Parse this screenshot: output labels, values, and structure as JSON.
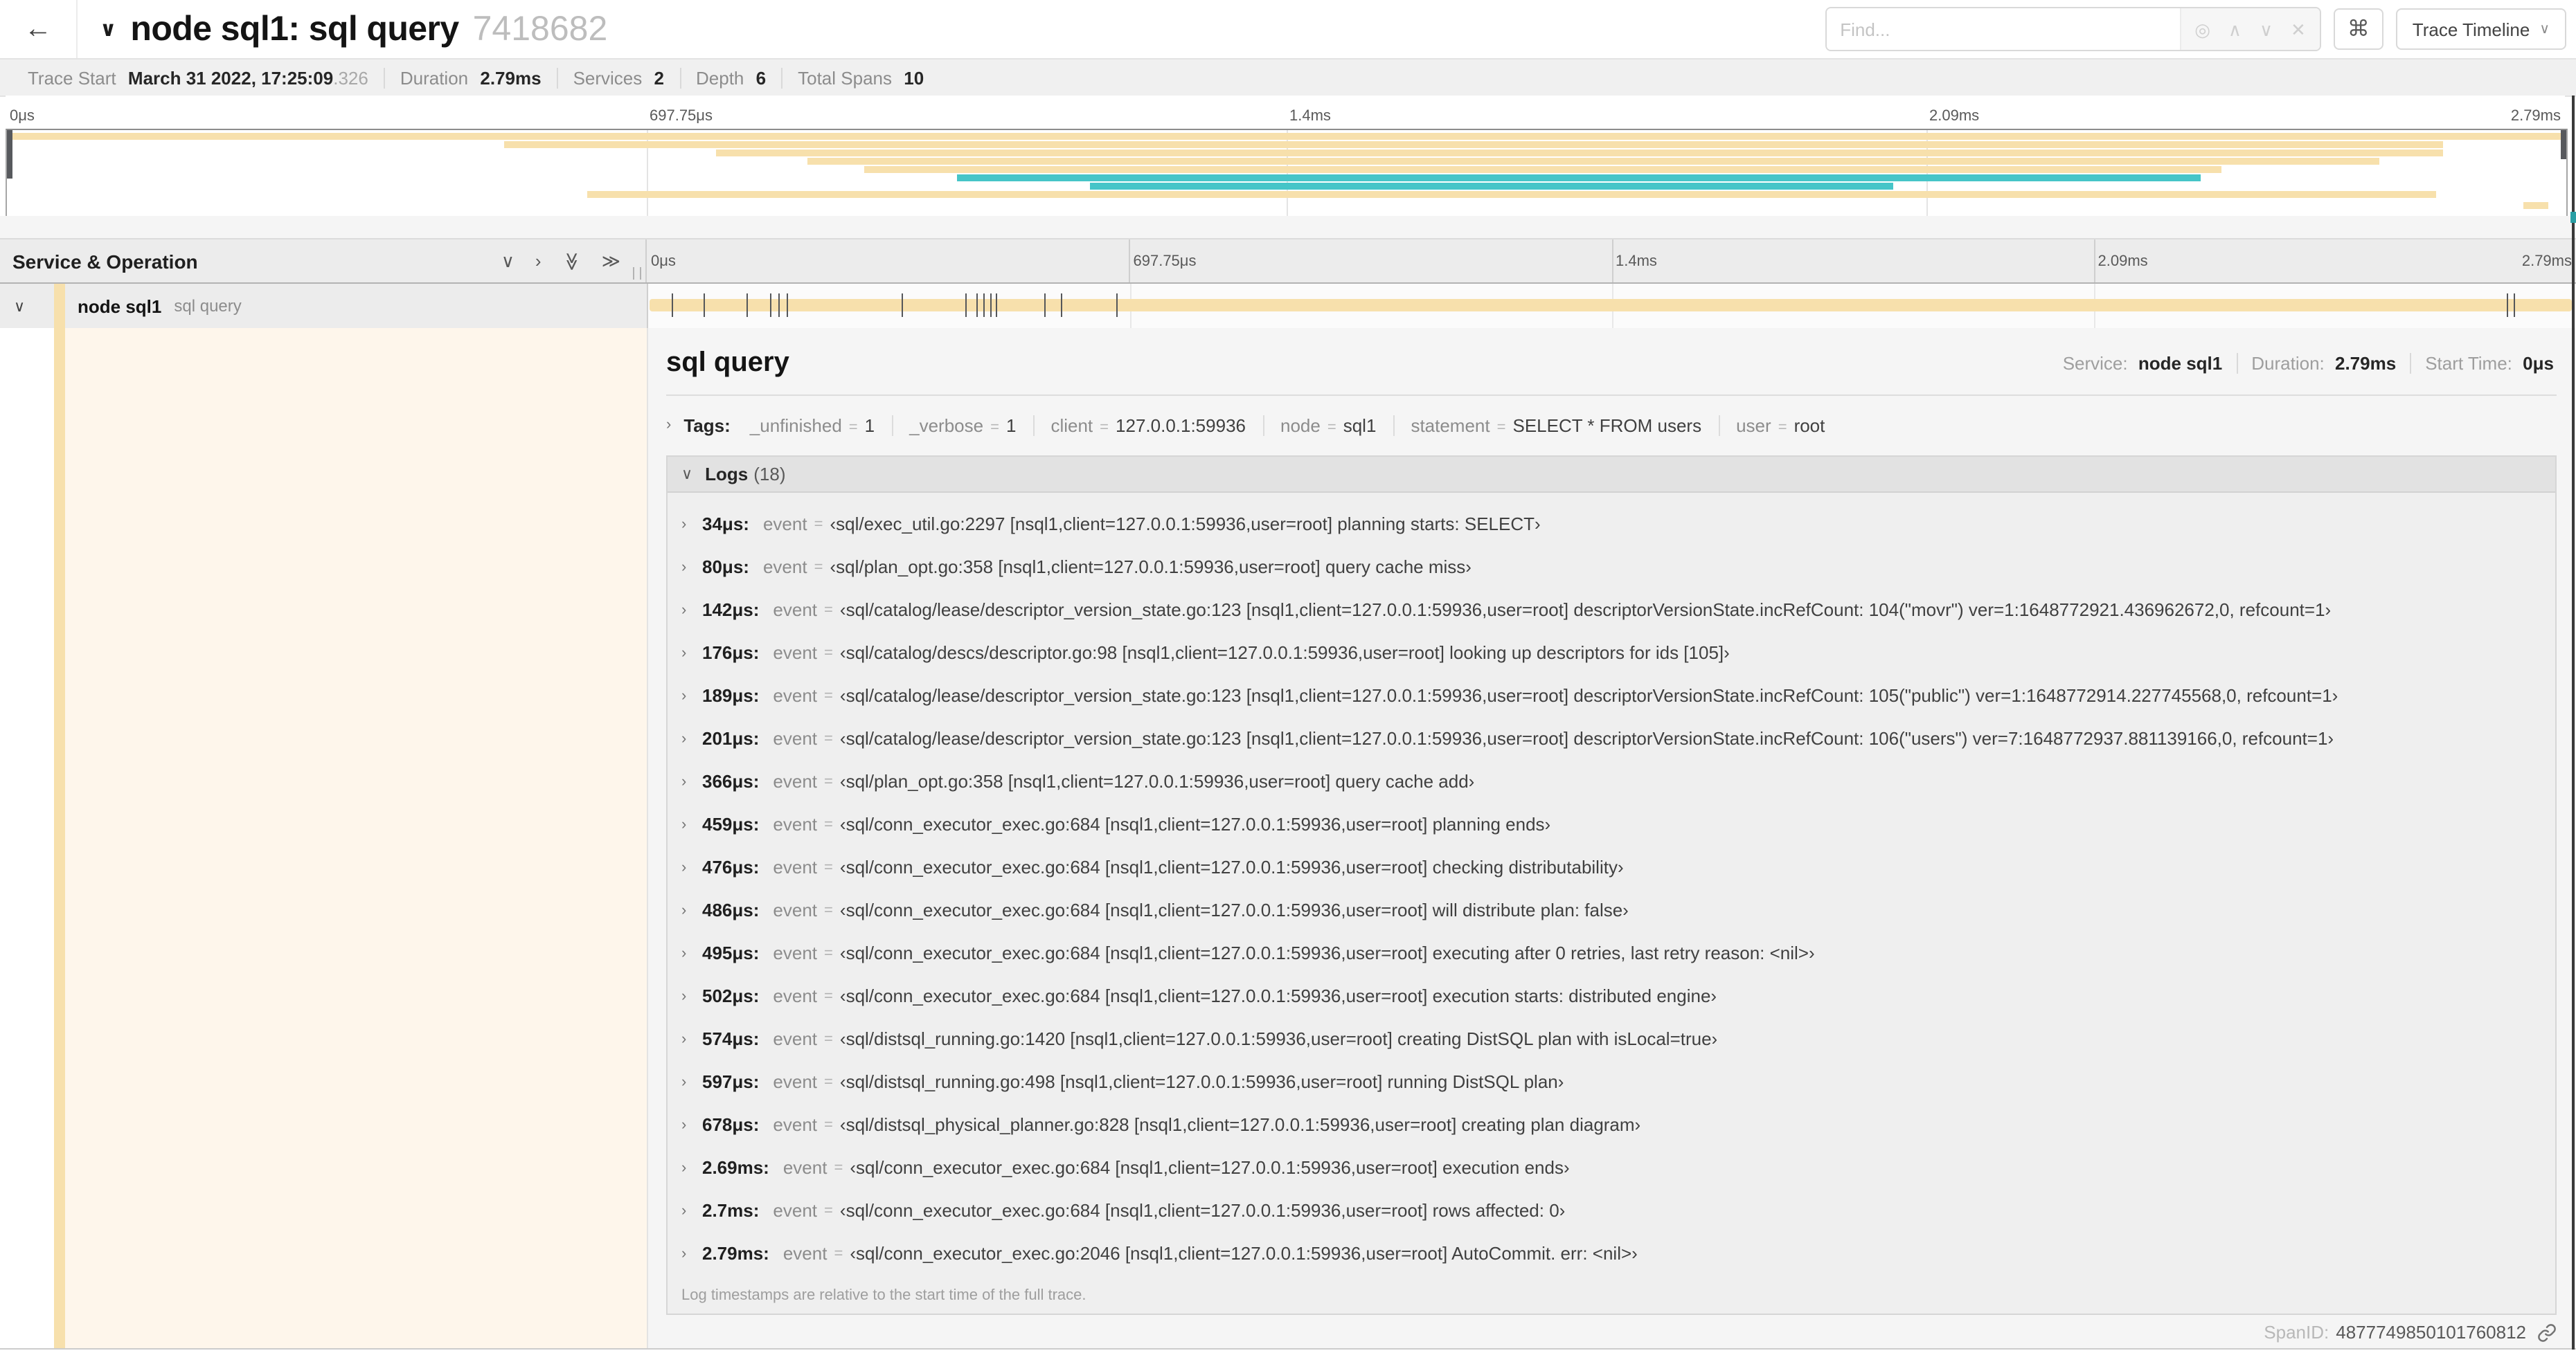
{
  "header": {
    "back_icon": "←",
    "collapse_chevron": "∨",
    "title": "node sql1: sql query",
    "trace_id": "7418682",
    "find": {
      "placeholder": "Find...",
      "icons": [
        "◎",
        "∧",
        "∨",
        "✕"
      ]
    },
    "shortcut_button": "⌘",
    "view_dropdown": {
      "label": "Trace Timeline",
      "chevron": "∨"
    }
  },
  "summary": {
    "items": [
      {
        "label": "Trace Start",
        "value": "March 31 2022, 17:25:09",
        "suffix": ".326"
      },
      {
        "label": "Duration",
        "value": "2.79ms"
      },
      {
        "label": "Services",
        "value": "2"
      },
      {
        "label": "Depth",
        "value": "6"
      },
      {
        "label": "Total Spans",
        "value": "10"
      }
    ]
  },
  "ruler": {
    "ticks": [
      {
        "label": "0μs",
        "css": "left:3px"
      },
      {
        "label": "697.75μs",
        "css": "left:calc(25% + 3px)"
      },
      {
        "label": "1.4ms",
        "css": "left:calc(50% + 3px)"
      },
      {
        "label": "2.09ms",
        "css": "left:calc(75% + 3px)"
      },
      {
        "label": "2.79ms",
        "css": "right:3px"
      }
    ]
  },
  "minimap": {
    "colors": {
      "tan": "#f7e0ac",
      "teal": "#46c5c8"
    },
    "spans": [
      {
        "c": "#f7e0ac",
        "l": 0,
        "w": 100,
        "t": "2px"
      },
      {
        "c": "#f7e0ac",
        "l": 19.4,
        "w": 75.8,
        "t": "8px"
      },
      {
        "c": "#f7e0ac",
        "l": 27.7,
        "w": 67.5,
        "t": "14px"
      },
      {
        "c": "#f7e0ac",
        "l": 31.3,
        "w": 61.4,
        "t": "20px"
      },
      {
        "c": "#f7e0ac",
        "l": 33.5,
        "w": 53.0,
        "t": "26px"
      },
      {
        "c": "#46c5c8",
        "l": 37.1,
        "w": 48.6,
        "t": "32px"
      },
      {
        "c": "#46c5c8",
        "l": 42.3,
        "w": 31.4,
        "t": "38px"
      },
      {
        "c": "#f7e0ac",
        "l": 22.7,
        "w": 72.2,
        "t": "44px"
      },
      {
        "c": "#f7e0ac",
        "l": 98.3,
        "w": 1.0,
        "t": "52px"
      }
    ]
  },
  "timeline": {
    "left_header": "Service & Operation",
    "icons": {
      "collapse_one": "∨",
      "expand_one": "›",
      "collapse_all": "≫",
      "expand_all": "≫"
    },
    "span": {
      "service": "node sql1",
      "operation": "sql query"
    },
    "log_ticks": [
      {
        "p": 1.22
      },
      {
        "p": 2.87
      },
      {
        "p": 5.09
      },
      {
        "p": 6.31
      },
      {
        "p": 6.77
      },
      {
        "p": 7.2
      },
      {
        "p": 13.12
      },
      {
        "p": 16.45
      },
      {
        "p": 17.06
      },
      {
        "p": 17.42
      },
      {
        "p": 17.74
      },
      {
        "p": 18.0
      },
      {
        "p": 20.57
      },
      {
        "p": 21.4
      },
      {
        "p": 24.3
      },
      {
        "p": 96.42
      },
      {
        "p": 96.77
      }
    ]
  },
  "detail": {
    "eq": "=",
    "title": "sql query",
    "meta": [
      {
        "label": "Service:",
        "value": "node sql1"
      },
      {
        "label": "Duration:",
        "value": "2.79ms"
      },
      {
        "label": "Start Time:",
        "value": "0μs"
      }
    ],
    "tags_chevron": "›",
    "tags_label": "Tags:",
    "tags": [
      {
        "key": "_unfinished",
        "value": "1"
      },
      {
        "key": "_verbose",
        "value": "1"
      },
      {
        "key": "client",
        "value": "127.0.0.1:59936"
      },
      {
        "key": "node",
        "value": "sql1"
      },
      {
        "key": "statement",
        "value": "SELECT * FROM users"
      },
      {
        "key": "user",
        "value": "root"
      }
    ],
    "logs": {
      "chevron": "∨",
      "title": "Logs",
      "count": "(18)",
      "row_chevron": "›",
      "key": "event",
      "entries": [
        {
          "time": "34μs:",
          "key": "event",
          "value": "‹sql/exec_util.go:2297 [nsql1,client=127.0.0.1:59936,user=root] planning starts: SELECT›"
        },
        {
          "time": "80μs:",
          "key": "event",
          "value": "‹sql/plan_opt.go:358 [nsql1,client=127.0.0.1:59936,user=root] query cache miss›"
        },
        {
          "time": "142μs:",
          "key": "event",
          "value": "‹sql/catalog/lease/descriptor_version_state.go:123 [nsql1,client=127.0.0.1:59936,user=root] descriptorVersionState.incRefCount: 104(\"movr\") ver=1:1648772921.436962672,0, refcount=1›"
        },
        {
          "time": "176μs:",
          "key": "event",
          "value": "‹sql/catalog/descs/descriptor.go:98 [nsql1,client=127.0.0.1:59936,user=root] looking up descriptors for ids [105]›"
        },
        {
          "time": "189μs:",
          "key": "event",
          "value": "‹sql/catalog/lease/descriptor_version_state.go:123 [nsql1,client=127.0.0.1:59936,user=root] descriptorVersionState.incRefCount: 105(\"public\") ver=1:1648772914.227745568,0, refcount=1›"
        },
        {
          "time": "201μs:",
          "key": "event",
          "value": "‹sql/catalog/lease/descriptor_version_state.go:123 [nsql1,client=127.0.0.1:59936,user=root] descriptorVersionState.incRefCount: 106(\"users\") ver=7:1648772937.881139166,0, refcount=1›"
        },
        {
          "time": "366μs:",
          "key": "event",
          "value": "‹sql/plan_opt.go:358 [nsql1,client=127.0.0.1:59936,user=root] query cache add›"
        },
        {
          "time": "459μs:",
          "key": "event",
          "value": "‹sql/conn_executor_exec.go:684 [nsql1,client=127.0.0.1:59936,user=root] planning ends›"
        },
        {
          "time": "476μs:",
          "key": "event",
          "value": "‹sql/conn_executor_exec.go:684 [nsql1,client=127.0.0.1:59936,user=root] checking distributability›"
        },
        {
          "time": "486μs:",
          "key": "event",
          "value": "‹sql/conn_executor_exec.go:684 [nsql1,client=127.0.0.1:59936,user=root] will distribute plan: false›"
        },
        {
          "time": "495μs:",
          "key": "event",
          "value": "‹sql/conn_executor_exec.go:684 [nsql1,client=127.0.0.1:59936,user=root] executing after 0 retries, last retry reason: <nil>›"
        },
        {
          "time": "502μs:",
          "key": "event",
          "value": "‹sql/conn_executor_exec.go:684 [nsql1,client=127.0.0.1:59936,user=root] execution starts: distributed engine›"
        },
        {
          "time": "574μs:",
          "key": "event",
          "value": "‹sql/distsql_running.go:1420 [nsql1,client=127.0.0.1:59936,user=root] creating DistSQL plan with isLocal=true›"
        },
        {
          "time": "597μs:",
          "key": "event",
          "value": "‹sql/distsql_running.go:498 [nsql1,client=127.0.0.1:59936,user=root] running DistSQL plan›"
        },
        {
          "time": "678μs:",
          "key": "event",
          "value": "‹sql/distsql_physical_planner.go:828 [nsql1,client=127.0.0.1:59936,user=root] creating plan diagram›"
        },
        {
          "time": "2.69ms:",
          "key": "event",
          "value": "‹sql/conn_executor_exec.go:684 [nsql1,client=127.0.0.1:59936,user=root] execution ends›"
        },
        {
          "time": "2.7ms:",
          "key": "event",
          "value": "‹sql/conn_executor_exec.go:684 [nsql1,client=127.0.0.1:59936,user=root] rows affected: 0›"
        },
        {
          "time": "2.79ms:",
          "key": "event",
          "value": "‹sql/conn_executor_exec.go:2046 [nsql1,client=127.0.0.1:59936,user=root] AutoCommit. err: <nil>›"
        }
      ],
      "footnote": "Log timestamps are relative to the start time of the full trace."
    },
    "footer": {
      "label": "SpanID:",
      "value": "4877749850101760812"
    }
  }
}
